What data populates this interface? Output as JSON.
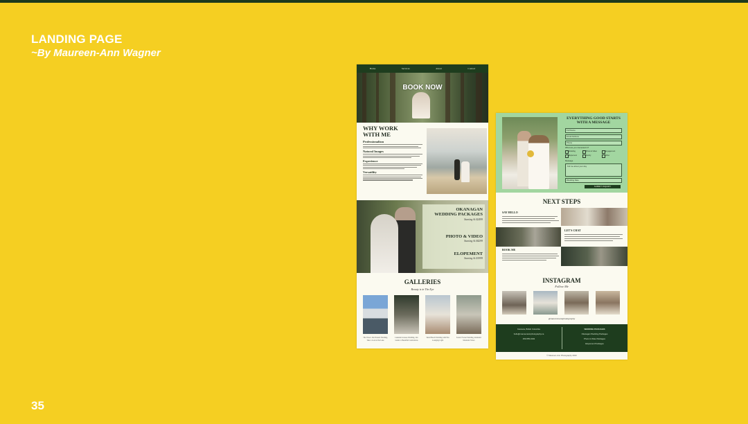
{
  "slide": {
    "title": "LANDING PAGE",
    "subtitle": "~By Maureen-Ann Wagner",
    "page_number": "35",
    "colors": {
      "background": "#f5cf22",
      "accent_dark_green": "#1e3d1e",
      "mint": "#a2d6a0"
    }
  },
  "mockup1": {
    "nav": [
      "Home",
      "Services",
      "About",
      "Contact"
    ],
    "hero_button": "BOOK NOW",
    "why": {
      "heading_line1": "WHY WORK",
      "heading_line2": "WITH ME",
      "points": [
        "Professionalism",
        "Natural Images",
        "Experience",
        "Versatility"
      ]
    },
    "packages": [
      {
        "title_line1": "OKANAGAN",
        "title_line2": "WEDDING PACKAGES",
        "sub": "Starting At $2499"
      },
      {
        "title_line1": "PHOTO & VIDEO",
        "title_line2": "",
        "sub": "Starting At $4299"
      },
      {
        "title_line1": "ELOPEMENT",
        "title_line2": "",
        "sub": "Starting At $1999"
      }
    ],
    "galleries": {
      "heading": "GALLERIES",
      "subheading": "Beauty is in The Eye",
      "captions": [
        "The Views: Our Natural Wedding, Take a Look at the Lake",
        "Lakeside Grasses Wedding, Our Guide to Beautiful Celebrations",
        "Small Beach Wedding with Fun Lounging Light",
        "Scenic Forrest Wedding, Romantic Mountain Views"
      ]
    }
  },
  "mockup2": {
    "contact": {
      "heading_line1": "EVERYTHING GOOD STARTS",
      "heading_line2": "WITH A MESSAGE",
      "fields": [
        "Full Name",
        "Email Address",
        "Phone"
      ],
      "question": "What are you interested in?",
      "options": [
        "Wedding",
        "Photo & Video",
        "Engagement",
        "Elopement",
        "Family",
        "Other"
      ],
      "message_label": "Message",
      "message_placeholder": "Tell me about your day",
      "date_field": "Wedding Date",
      "submit": "SUBMIT INQUIRY"
    },
    "next_steps": {
      "heading": "NEXT STEPS",
      "steps": [
        "SAY HELLO",
        "LET'S CHAT",
        "BOOK ME"
      ]
    },
    "instagram": {
      "heading": "INSTAGRAM",
      "subheading": "Follow Me",
      "handle": "@maureenannphotography"
    },
    "footer": {
      "left_lines": [
        "Kelowna, British Columbia",
        "hello@maureenannphotography.ca",
        "250-555-0192"
      ],
      "right_heading": "WEDDING PACKAGES",
      "right_lines": [
        "Okanagan Wedding Packages",
        "Photo & Video Packages",
        "Elopement Packages"
      ]
    },
    "copyright": "© Maureen-Ann Photography 2023"
  }
}
